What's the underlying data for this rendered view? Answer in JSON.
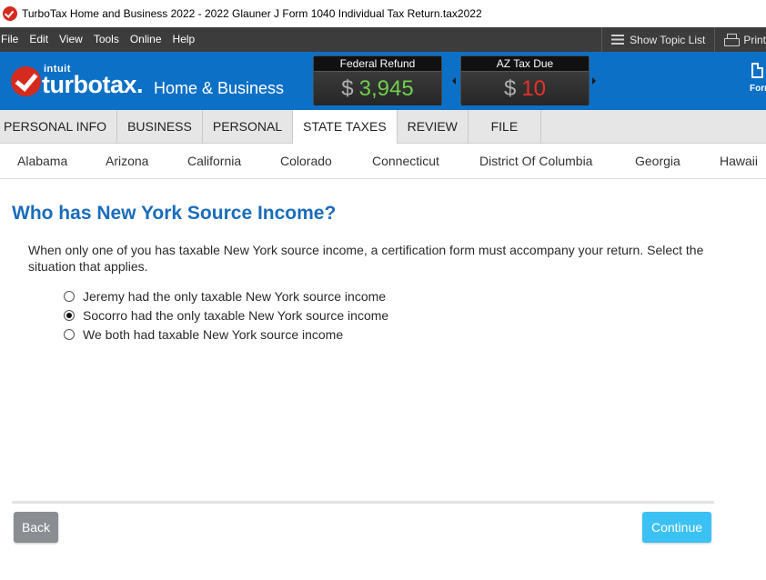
{
  "window": {
    "title": "TurboTax Home and Business 2022 - 2022 Glauner J Form 1040  Individual Tax Return.tax2022"
  },
  "menu": {
    "items": [
      "File",
      "Edit",
      "View",
      "Tools",
      "Online",
      "Help"
    ],
    "show_topic_list": "Show Topic List",
    "print": "Print"
  },
  "header": {
    "intuit": "intuit",
    "brand": "turbotax.",
    "edition": "Home & Business",
    "federal": {
      "label": "Federal Refund",
      "currency": "$",
      "amount": "3,945",
      "color": "#6fd04a"
    },
    "state": {
      "label": "AZ Tax Due",
      "currency": "$",
      "amount": "10",
      "color": "#e8302a"
    },
    "forms_label": "Forms"
  },
  "tabs": [
    {
      "label": "PERSONAL INFO",
      "active": false
    },
    {
      "label": "BUSINESS",
      "active": false
    },
    {
      "label": "PERSONAL",
      "active": false
    },
    {
      "label": "STATE TAXES",
      "active": true
    },
    {
      "label": "REVIEW",
      "active": false
    },
    {
      "label": "FILE",
      "active": false
    }
  ],
  "states": [
    "Alabama",
    "Arizona",
    "California",
    "Colorado",
    "Connecticut",
    "District Of Columbia",
    "Georgia",
    "Hawaii"
  ],
  "main": {
    "title": "Who has New York Source Income?",
    "instructions": "When only one of you has taxable New York source income, a certification form must accompany your return. Select the situation that applies.",
    "options": [
      {
        "label": "Jeremy had the only taxable New York source income",
        "selected": false
      },
      {
        "label": "Socorro had the only taxable New York source income",
        "selected": true
      },
      {
        "label": "We both had taxable New York source income",
        "selected": false
      }
    ]
  },
  "footer": {
    "back_label": "Back",
    "continue_label": "Continue"
  },
  "colors": {
    "header_blue": "#0d70c7",
    "title_blue": "#1a6dbb",
    "continue_button": "#3cc1f4",
    "back_button": "#8a8d92"
  }
}
